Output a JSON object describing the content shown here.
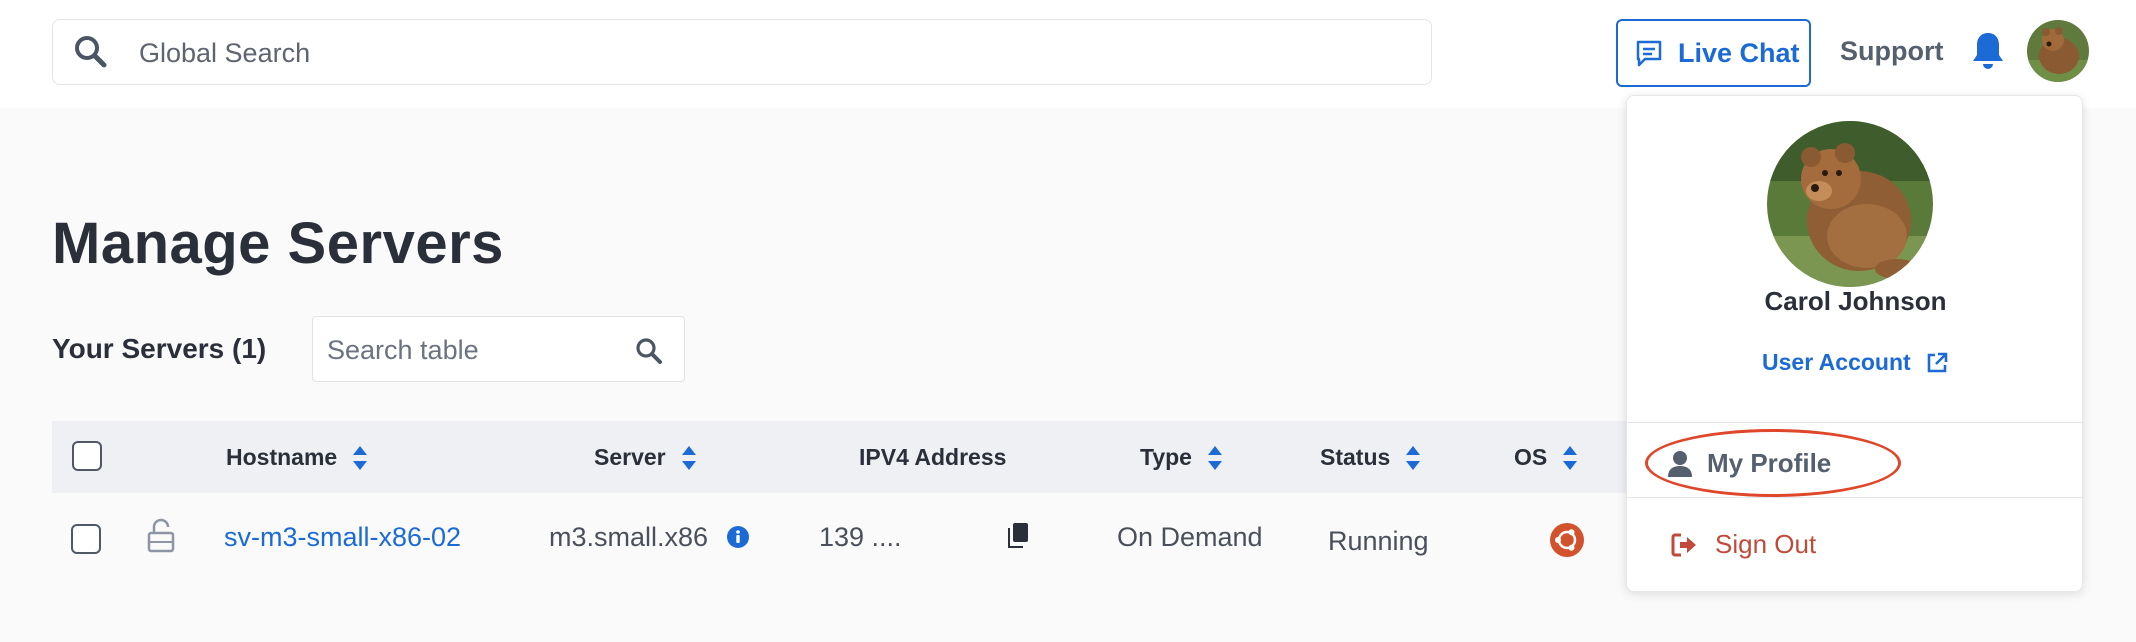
{
  "header": {
    "search_placeholder": "Global Search",
    "live_chat_label": "Live Chat",
    "support_label": "Support"
  },
  "page": {
    "title": "Manage Servers",
    "servers_count_label": "Your Servers (1)",
    "table_search_placeholder": "Search table"
  },
  "table": {
    "columns": [
      "Hostname",
      "Server",
      "IPV4 Address",
      "Type",
      "Status",
      "OS"
    ],
    "rows": [
      {
        "hostname": "sv-m3-small-x86-02",
        "server": "m3.small.x86",
        "ipv4": "139 ....",
        "type": "On Demand",
        "status": "Running",
        "os_icon": "ubuntu-icon"
      }
    ]
  },
  "user_menu": {
    "name": "Carol Johnson",
    "account_label": "User Account",
    "profile_label": "My Profile",
    "signout_label": "Sign Out"
  },
  "colors": {
    "accent": "#1b6ad6",
    "ubuntu": "#d1522c",
    "signout": "#c24a3a",
    "highlight": "#e0462a"
  }
}
